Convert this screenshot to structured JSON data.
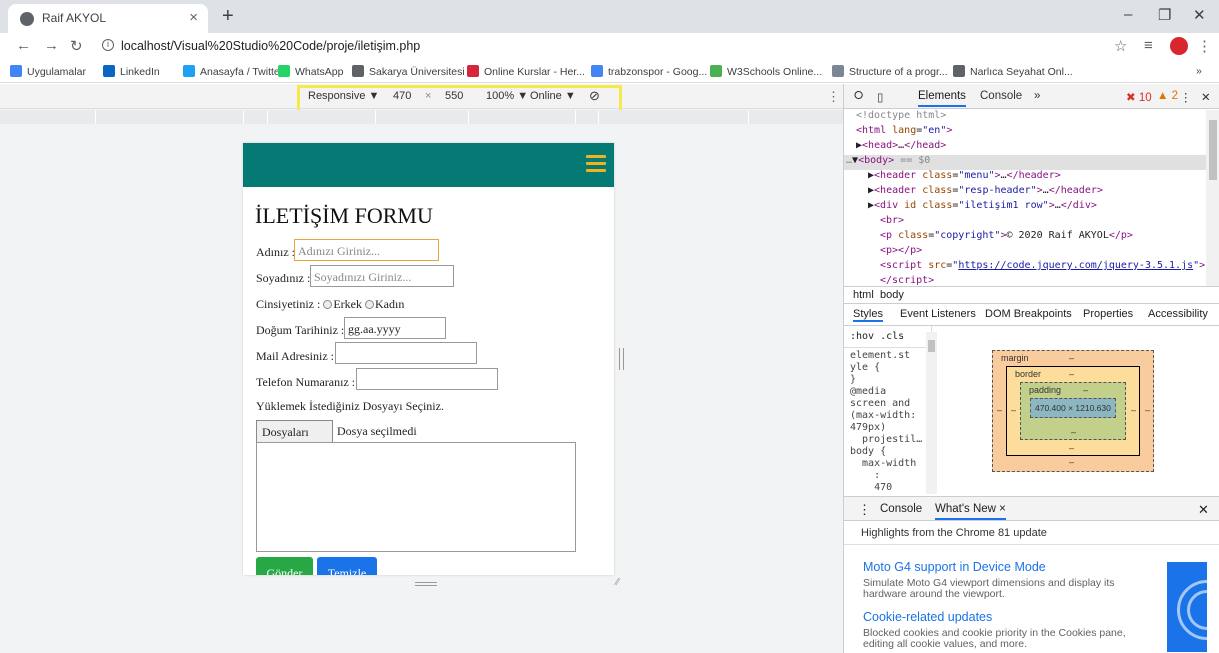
{
  "browser": {
    "tab_title": "Raif AKYOL",
    "tab_close": "×",
    "new_tab": "+",
    "url": "localhost/Visual%20Studio%20Code/proje/iletişim.php"
  },
  "bookmarks": [
    {
      "label": "Uygulamalar",
      "color": "#4285f4"
    },
    {
      "label": "LinkedIn",
      "color": "#0a66c2"
    },
    {
      "label": "Anasayfa / Twitter",
      "color": "#1da1f2"
    },
    {
      "label": "WhatsApp",
      "color": "#25d366"
    },
    {
      "label": "Sakarya Üniversitesi",
      "color": "#5f6368"
    },
    {
      "label": "Online Kurslar - Her...",
      "color": "#d6263c"
    },
    {
      "label": "trabzonspor - Goog...",
      "color": "#4285f4"
    },
    {
      "label": "W3Schools Online...",
      "color": "#4caf50"
    },
    {
      "label": "Structure of a progr...",
      "color": "#7b8794"
    },
    {
      "label": "Narlıca Seyahat Onl...",
      "color": "#5f6368"
    }
  ],
  "device_toolbar": {
    "device": "Responsive ▼",
    "width": "470",
    "times": "×",
    "height": "550",
    "zoom": "100% ▼",
    "network": "Online ▼"
  },
  "page": {
    "title": "İLETİŞİM FORMU",
    "name_label": "Adınız :",
    "name_placeholder": "Adınızı Giriniz...",
    "surname_label": "Soyadınız :",
    "surname_placeholder": "Soyadınızı Giriniz...",
    "gender_label": "Cinsiyetiniz :",
    "gender_male": "Erkek",
    "gender_female": "Kadın",
    "birth_label": "Doğum Tarihiniz :",
    "birth_value": "gg.aa.yyyy",
    "mail_label": "Mail Adresiniz :",
    "phone_label": "Telefon Numaranız :",
    "upload_label": "Yüklemek İstediğiniz Dosyayı Seçiniz.",
    "file_button": "Dosyaları Seç",
    "file_status": "Dosya seçilmedi",
    "send_button": "Gönder",
    "clear_button": "Temizle",
    "header_color": "#057a75",
    "hamburger_color": "#f3b21e"
  },
  "devtools": {
    "tabs": [
      "Elements",
      "Console",
      "»"
    ],
    "errors": "10",
    "warnings": "2",
    "dom_lines": [
      {
        "indent": 1,
        "html": "<span class='cmt'>&lt;!doctype html&gt;</span>"
      },
      {
        "indent": 1,
        "html": "<span class='tag'>&lt;html</span> <span class='attr'>lang</span>=<span class='aval'>\"en\"</span><span class='tag'>&gt;</span>"
      },
      {
        "indent": 1,
        "html": "▶<span class='tag'>&lt;head&gt;</span>…<span class='tag'>&lt;/head&gt;</span>"
      },
      {
        "indent": 0,
        "html": "<span class='cmt'>…</span>▼<span class='tag'>&lt;body&gt;</span> <span class='cmt'>== $0</span>",
        "selected": true
      },
      {
        "indent": 2,
        "html": "▶<span class='tag'>&lt;header</span> <span class='attr'>class</span>=<span class='aval'>\"menu\"</span><span class='tag'>&gt;</span>…<span class='tag'>&lt;/header&gt;</span>"
      },
      {
        "indent": 2,
        "html": "▶<span class='tag'>&lt;header</span> <span class='attr'>class</span>=<span class='aval'>\"resp-header\"</span><span class='tag'>&gt;</span>…<span class='tag'>&lt;/header&gt;</span>"
      },
      {
        "indent": 2,
        "html": "▶<span class='tag'>&lt;div</span> <span class='attr'>id</span> <span class='attr'>class</span>=<span class='aval'>\"iletişim1 row\"</span><span class='tag'>&gt;</span>…<span class='tag'>&lt;/div&gt;</span>"
      },
      {
        "indent": 3,
        "html": "<span class='tag'>&lt;br&gt;</span>"
      },
      {
        "indent": 3,
        "html": "<span class='tag'>&lt;p</span> <span class='attr'>class</span>=<span class='aval'>\"copyright\"</span><span class='tag'>&gt;</span>© 2020 Raif AKYOL<span class='tag'>&lt;/p&gt;</span>"
      },
      {
        "indent": 3,
        "html": "<span class='tag'>&lt;p&gt;&lt;/p&gt;</span>"
      },
      {
        "indent": 3,
        "html": "<span class='tag'>&lt;script</span> <span class='attr'>src</span>=<span class='aval'>\"<span class='lnk'>https://code.jquery.com/jquery-3.5.1.js</span>\"</span><span class='tag'>&gt;</span>"
      },
      {
        "indent": 3,
        "html": "<span class='tag'>&lt;/script&gt;</span>"
      }
    ],
    "crumbs": [
      "html",
      "body"
    ],
    "style_tabs": [
      "Styles",
      "Event Listeners",
      "DOM Breakpoints",
      "Properties",
      "Accessibility"
    ],
    "filter": ":hov  .cls",
    "styles_text": [
      "element.st",
      "yle {",
      "}",
      "@media",
      "screen and",
      "(max-width:",
      "479px)",
      "  projestil…",
      "body {",
      "  max-width",
      "    :",
      "    470"
    ],
    "box": {
      "margin": "margin",
      "border": "border",
      "padding": "padding",
      "content": "470.400 × 1210.630",
      "dash": "–"
    },
    "drawer_tabs": [
      "Console",
      "What's New ×"
    ],
    "highlights": "Highlights from the Chrome 81 update",
    "news": [
      {
        "title": "Moto G4 support in Device Mode",
        "desc": "Simulate Moto G4 viewport dimensions and display its hardware around the viewport."
      },
      {
        "title": "Cookie-related updates",
        "desc": "Blocked cookies and cookie priority in the Cookies pane, editing all cookie values, and more."
      }
    ]
  }
}
